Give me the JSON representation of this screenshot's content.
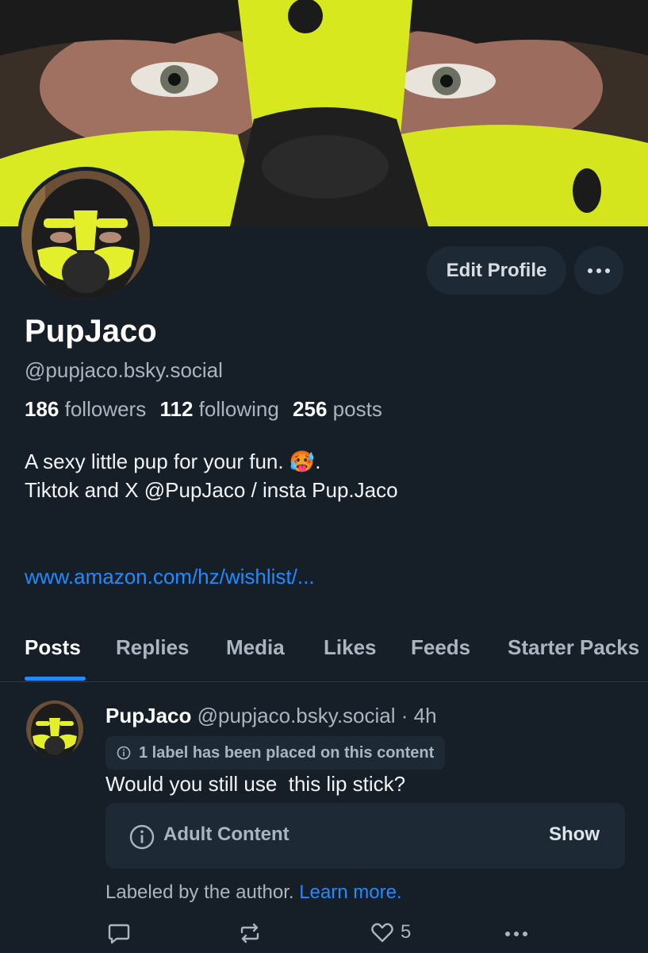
{
  "profile": {
    "display_name": "PupJaco",
    "handle": "@pupjaco.bsky.social",
    "edit_label": "Edit Profile",
    "stats": {
      "followers_count": "186",
      "followers_label": "followers",
      "following_count": "112",
      "following_label": "following",
      "posts_count": "256",
      "posts_label": "posts"
    },
    "bio_line1": "A sexy little pup for your fun. 🥵.",
    "bio_line2": "Tiktok and X @PupJaco / insta Pup.Jaco",
    "link": "www.amazon.com/hz/wishlist/..."
  },
  "tabs": [
    {
      "label": "Posts",
      "active": true
    },
    {
      "label": "Replies",
      "active": false
    },
    {
      "label": "Media",
      "active": false
    },
    {
      "label": "Likes",
      "active": false
    },
    {
      "label": "Feeds",
      "active": false
    },
    {
      "label": "Starter Packs",
      "active": false
    }
  ],
  "post": {
    "author": "PupJaco",
    "handle": "@pupjaco.bsky.social",
    "time": "· 4h",
    "label_notice": "1 label has been placed on this content",
    "text": "Would you still use  this lip stick?",
    "warning_label": "Adult Content",
    "show_label": "Show",
    "labeled_by": "Labeled by the author.",
    "learn_more": "Learn more.",
    "like_count": "5"
  },
  "colors": {
    "background": "#161e27",
    "accent": "#208bfe",
    "muted_text": "#aab5c2",
    "pill_bg": "#1e2936",
    "mask_yellow": "#e4ef2b"
  },
  "icons": [
    "more-icon",
    "info-icon",
    "reply-icon",
    "repost-icon",
    "like-icon",
    "post-more-icon"
  ]
}
